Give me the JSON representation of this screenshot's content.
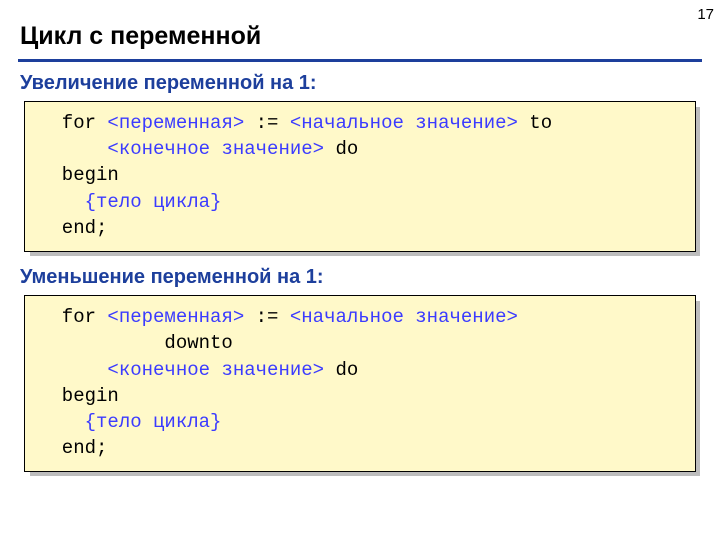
{
  "page_number": "17",
  "title": "Цикл с переменной",
  "section1": {
    "subtitle": "Увеличение переменной на 1:",
    "code": {
      "l1a": "  for ",
      "l1b": "<переменная>",
      "l1c": " := ",
      "l1d": "<начальное значение>",
      "l1e": " to",
      "l2a": "      ",
      "l2b": "<конечное значение>",
      "l2c": " do",
      "l3": "  begin",
      "l4a": "    ",
      "l4b": "{тело цикла}",
      "l5": "  end;"
    }
  },
  "section2": {
    "subtitle": "Уменьшение переменной на 1:",
    "code": {
      "l1a": "  for ",
      "l1b": "<переменная>",
      "l1c": " := ",
      "l1d": "<начальное значение>",
      "l2a": "           downto",
      "l3a": "      ",
      "l3b": "<конечное значение>",
      "l3c": " do",
      "l4": "  begin",
      "l5a": "    ",
      "l5b": "{тело цикла}",
      "l6": "  end;"
    }
  }
}
